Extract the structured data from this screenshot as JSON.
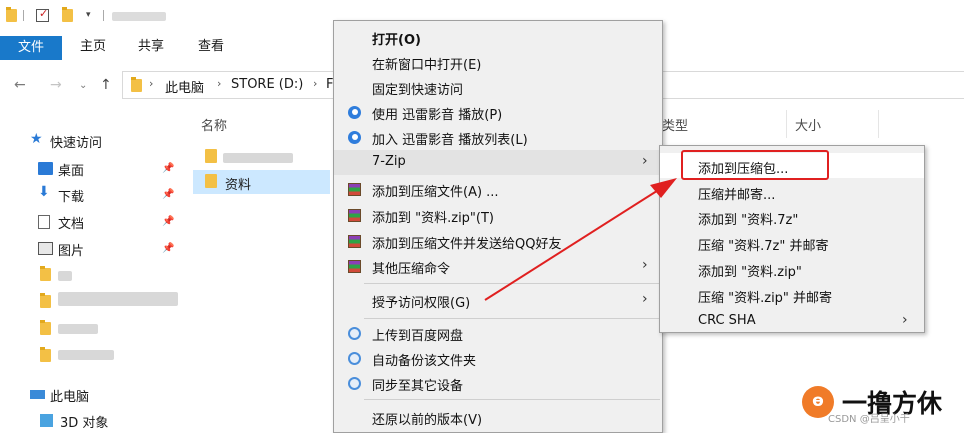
{
  "ribbon": {
    "file": "文件",
    "home": "主页",
    "share": "共享",
    "view": "查看"
  },
  "address": {
    "pc": "此电脑",
    "drive": "STORE (D:)",
    "next": "F"
  },
  "nav": {
    "quick_access": "快速访问",
    "items": [
      {
        "label": "桌面",
        "icon": "desktop-icon"
      },
      {
        "label": "下载",
        "icon": "download-icon"
      },
      {
        "label": "文档",
        "icon": "document-icon"
      },
      {
        "label": "图片",
        "icon": "picture-icon"
      }
    ],
    "this_pc": "此电脑",
    "objects3d": "3D 对象"
  },
  "columns": {
    "name": "名称",
    "type": "类型",
    "size": "大小"
  },
  "files": {
    "selected": "资料"
  },
  "context_menu": {
    "open": "打开(O)",
    "open_new_window": "在新窗口中打开(E)",
    "pin_quick": "固定到快速访问",
    "thunder_play": "使用 迅雷影音 播放(P)",
    "thunder_add": "加入 迅雷影音 播放列表(L)",
    "sevenzip": "7-Zip",
    "add_archive": "添加到压缩文件(A) ...",
    "add_zip": "添加到 \"资料.zip\"(T)",
    "add_qq": "添加到压缩文件并发送给QQ好友",
    "other_compress": "其他压缩命令",
    "grant_access": "授予访问权限(G)",
    "baidu_upload": "上传到百度网盘",
    "auto_backup": "自动备份该文件夹",
    "sync_devices": "同步至其它设备",
    "restore": "还原以前的版本(V)"
  },
  "submenu": {
    "add_to_archive": "添加到压缩包...",
    "compress_email": "压缩并邮寄...",
    "add_7z": "添加到 \"资料.7z\"",
    "compress_7z_email": "压缩 \"资料.7z\" 并邮寄",
    "add_zip": "添加到 \"资料.zip\"",
    "compress_zip_email": "压缩 \"资料.zip\" 并邮寄",
    "crc": "CRC SHA"
  },
  "watermark": {
    "logo": "ɵ",
    "brand": "一撸方休",
    "small": "CSDN @吕呈小千"
  },
  "colors": {
    "accent": "#1979ca",
    "selection": "#cce8ff",
    "annotation": "#e02020"
  }
}
